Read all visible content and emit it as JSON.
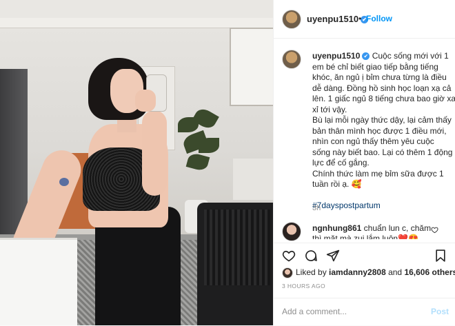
{
  "post": {
    "username": "uyenpu1510",
    "verified_badge": "✔",
    "follow_label": "Follow",
    "separator": "•",
    "caption_lines": [
      "Cuộc sống mới với 1",
      "em bé chỉ biết giao tiếp bằng tiếng",
      "khóc, ăn ngủ ị bỉm chưa từng là điều",
      "dễ dàng. Đồng hồ sinh học loạn xạ cả",
      "lên. 1 giấc ngủ 8 tiếng chưa bao giờ xa",
      "xỉ tới vậy.",
      "Bù lại mỗi ngày thức dậy, lại cảm thấy",
      "bản thân mình học được 1 điều mới,",
      "nhìn con ngủ thấy thêm yêu cuộc",
      "sống này biết bao. Lại có thêm 1 động",
      "lực để cố gắng.",
      "Chính thức làm mẹ bỉm sữa được 1",
      "tuần rồi ạ. 🥰"
    ],
    "hashtag": "#7dayspostpartum",
    "caption_time": "3h",
    "comment": {
      "username": "ngnhung861",
      "text_line1": " chuẩn lun c, chăm",
      "text_line2": "thì mặt mà zui lắm luôn❤️😍"
    },
    "likes": {
      "prefix": "Liked by ",
      "user": "iamdanny2808",
      "middle": " and ",
      "count": "16,606 others"
    },
    "timestamp": "3 HOURS AGO",
    "add_comment_placeholder": "Add a comment...",
    "post_label": "Post"
  },
  "icons": {
    "like": "heart-icon",
    "comment": "comment-icon",
    "share": "share-icon",
    "save": "bookmark-icon",
    "comment_like": "heart-icon"
  },
  "colors": {
    "link_blue": "#0095f6",
    "hashtag": "#00376b",
    "muted": "#8e8e8e",
    "post_disabled": "#b2dffc"
  }
}
